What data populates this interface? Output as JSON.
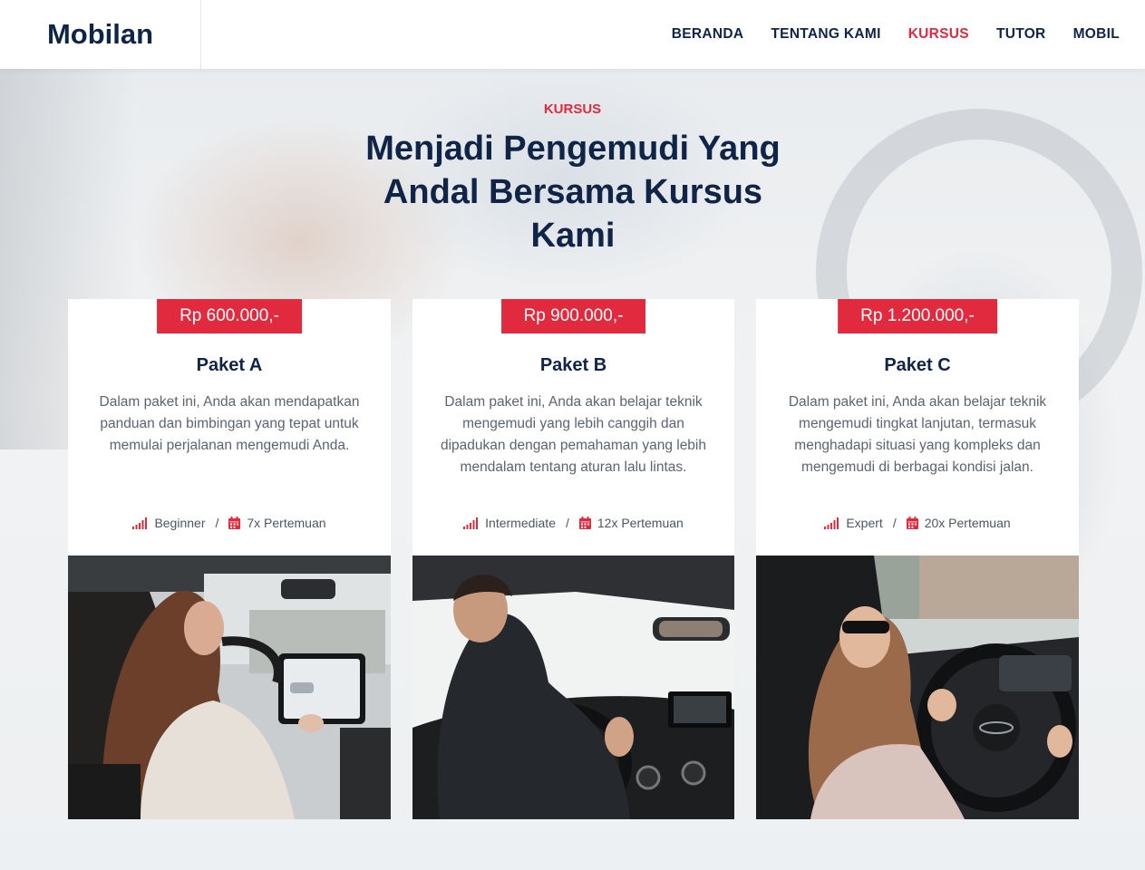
{
  "brand": "Mobilan",
  "nav": [
    {
      "label": "BERANDA",
      "active": false
    },
    {
      "label": "TENTANG KAMI",
      "active": false
    },
    {
      "label": "KURSUS",
      "active": true
    },
    {
      "label": "TUTOR",
      "active": false
    },
    {
      "label": "MOBIL",
      "active": false
    }
  ],
  "section": {
    "eyebrow": "KURSUS",
    "headline": "Menjadi Pengemudi Yang Andal Bersama Kursus Kami"
  },
  "colors": {
    "accent": "#e12a3d",
    "navy": "#0f2447"
  },
  "packages": [
    {
      "price": "Rp 600.000,-",
      "title": "Paket A",
      "description": "Dalam paket ini, Anda akan mendapatkan panduan dan bimbingan yang tepat untuk memulai perjalanan mengemudi Anda.",
      "level": "Beginner",
      "sessions": "7x Pertemuan",
      "level_icon": "signal-bars-icon",
      "sessions_icon": "calendar-icon",
      "photo": "woman-driving-electric-car-photo"
    },
    {
      "price": "Rp 900.000,-",
      "title": "Paket B",
      "description": "Dalam paket ini, Anda akan belajar teknik mengemudi yang lebih canggih dan dipadukan dengan pemahaman yang lebih mendalam tentang aturan lalu lintas.",
      "level": "Intermediate",
      "sessions": "12x Pertemuan",
      "level_icon": "signal-bars-icon",
      "sessions_icon": "calendar-icon",
      "photo": "man-driving-car-photo"
    },
    {
      "price": "Rp 1.200.000,-",
      "title": "Paket C",
      "description": "Dalam paket ini, Anda akan belajar teknik mengemudi tingkat lanjutan, termasuk menghadapi situasi yang kompleks dan mengemudi di berbagai kondisi jalan.",
      "level": "Expert",
      "sessions": "20x Pertemuan",
      "level_icon": "signal-bars-icon",
      "sessions_icon": "calendar-icon",
      "photo": "woman-with-sunglasses-driving-photo"
    }
  ]
}
